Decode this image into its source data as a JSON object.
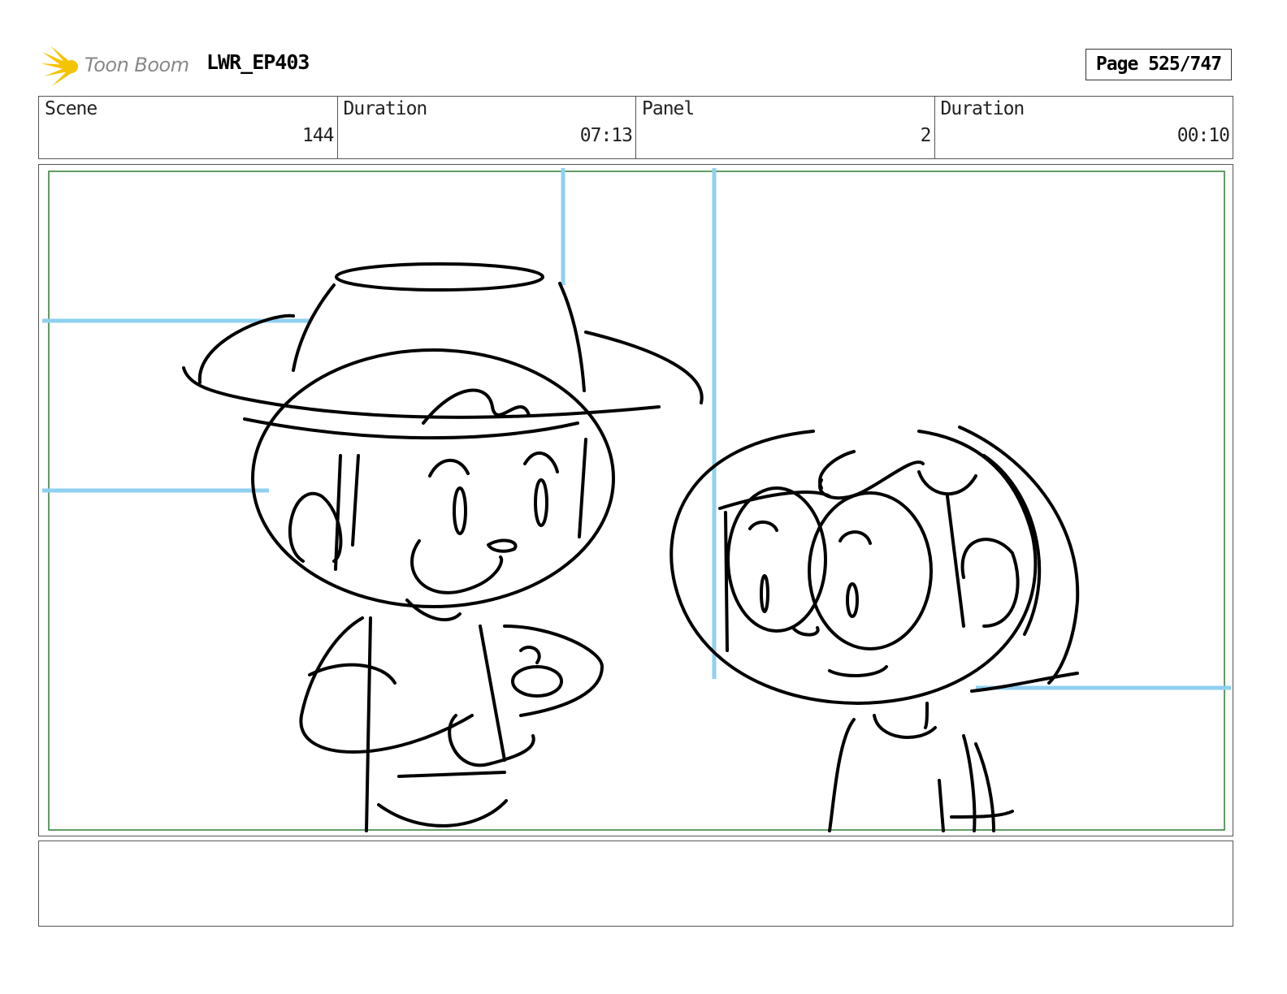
{
  "header": {
    "logo_text": "Toon Boom",
    "project": "LWR_EP403",
    "page_label": "Page 525/747"
  },
  "info": [
    {
      "label": "Scene",
      "value": "144"
    },
    {
      "label": "Duration",
      "value": "07:13"
    },
    {
      "label": "Panel",
      "value": "2"
    },
    {
      "label": "Duration",
      "value": "00:10"
    }
  ],
  "colors": {
    "guide_blue": "#8fd0f0",
    "safe_frame": "#2e7d32",
    "logo_yellow": "#f5c400",
    "ink": "#000000"
  },
  "notes": ""
}
